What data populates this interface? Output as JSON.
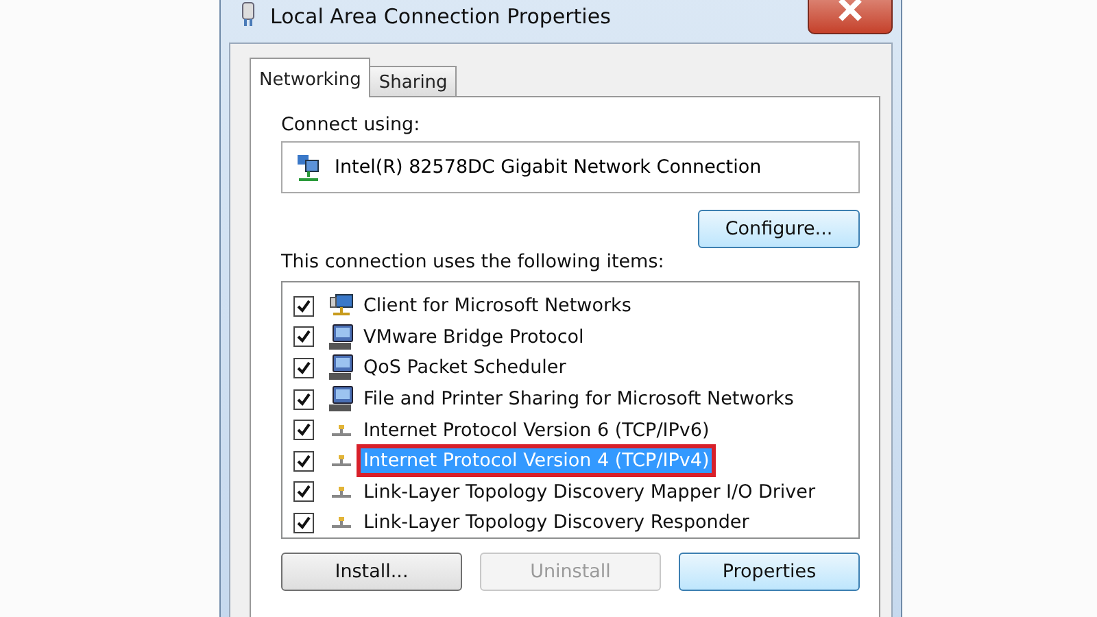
{
  "window": {
    "title": "Local Area Connection Properties"
  },
  "tabs": [
    {
      "label": "Networking",
      "selected": true
    },
    {
      "label": "Sharing",
      "selected": false
    }
  ],
  "connect_using": {
    "label": "Connect using:",
    "adapter": "Intel(R) 82578DC Gigabit Network Connection",
    "configure_button": "Configure..."
  },
  "items_label": "This connection uses the following items:",
  "items": [
    {
      "kind": "client",
      "label": "Client for Microsoft Networks",
      "checked": true,
      "selected": false,
      "highlighted": false
    },
    {
      "kind": "service",
      "label": "VMware Bridge Protocol",
      "checked": true,
      "selected": false,
      "highlighted": false
    },
    {
      "kind": "service",
      "label": "QoS Packet Scheduler",
      "checked": true,
      "selected": false,
      "highlighted": false
    },
    {
      "kind": "service",
      "label": "File and Printer Sharing for Microsoft Networks",
      "checked": true,
      "selected": false,
      "highlighted": false
    },
    {
      "kind": "protocol",
      "label": "Internet Protocol Version 6 (TCP/IPv6)",
      "checked": true,
      "selected": false,
      "highlighted": false
    },
    {
      "kind": "protocol",
      "label": "Internet Protocol Version 4 (TCP/IPv4)",
      "checked": true,
      "selected": true,
      "highlighted": true
    },
    {
      "kind": "protocol",
      "label": "Link-Layer Topology Discovery Mapper I/O Driver",
      "checked": true,
      "selected": false,
      "highlighted": false
    },
    {
      "kind": "protocol",
      "label": "Link-Layer Topology Discovery Responder",
      "checked": true,
      "selected": false,
      "highlighted": false
    }
  ],
  "buttons": [
    {
      "label": "Install...",
      "disabled": false
    },
    {
      "label": "Uninstall",
      "disabled": true
    },
    {
      "label": "Properties",
      "disabled": false
    }
  ]
}
